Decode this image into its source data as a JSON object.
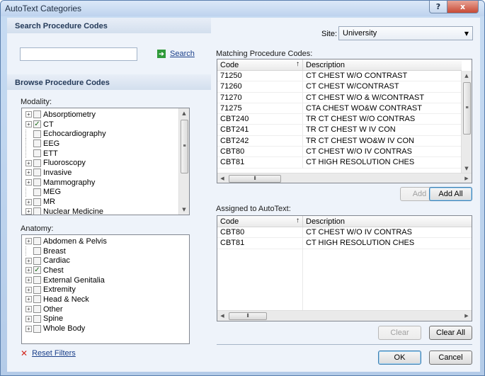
{
  "window": {
    "title": "AutoText Categories"
  },
  "titlebar": {
    "help": "?",
    "close": "x"
  },
  "search": {
    "header": "Search Procedure Codes",
    "input_value": "",
    "button_label": "Search"
  },
  "browse": {
    "header": "Browse Procedure Codes",
    "modality_label": "Modality:",
    "modality_items": [
      {
        "label": "Absorptiometry",
        "expandable": true,
        "checked": false
      },
      {
        "label": "CT",
        "expandable": true,
        "checked": true
      },
      {
        "label": "Echocardiography",
        "expandable": false,
        "checked": false
      },
      {
        "label": "EEG",
        "expandable": false,
        "checked": false
      },
      {
        "label": "ETT",
        "expandable": false,
        "checked": false
      },
      {
        "label": "Fluoroscopy",
        "expandable": true,
        "checked": false
      },
      {
        "label": "Invasive",
        "expandable": true,
        "checked": false
      },
      {
        "label": "Mammography",
        "expandable": true,
        "checked": false
      },
      {
        "label": "MEG",
        "expandable": false,
        "checked": false
      },
      {
        "label": "MR",
        "expandable": true,
        "checked": false
      },
      {
        "label": "Nuclear Medicine",
        "expandable": true,
        "checked": false
      }
    ],
    "anatomy_label": "Anatomy:",
    "anatomy_items": [
      {
        "label": "Abdomen & Pelvis",
        "expandable": true,
        "checked": false
      },
      {
        "label": "Breast",
        "expandable": false,
        "checked": false
      },
      {
        "label": "Cardiac",
        "expandable": true,
        "checked": false
      },
      {
        "label": "Chest",
        "expandable": true,
        "checked": true
      },
      {
        "label": "External Genitalia",
        "expandable": true,
        "checked": false
      },
      {
        "label": "Extremity",
        "expandable": true,
        "checked": false
      },
      {
        "label": "Head & Neck",
        "expandable": true,
        "checked": false
      },
      {
        "label": "Other",
        "expandable": true,
        "checked": false
      },
      {
        "label": "Spine",
        "expandable": true,
        "checked": false
      },
      {
        "label": "Whole Body",
        "expandable": true,
        "checked": false
      }
    ],
    "reset_label": "Reset Filters"
  },
  "site": {
    "label": "Site:",
    "value": "University"
  },
  "matching": {
    "label": "Matching Procedure Codes:",
    "col_code": "Code",
    "col_desc": "Description",
    "rows": [
      {
        "code": "71250",
        "desc": "CT CHEST W/O CONTRAST"
      },
      {
        "code": "71260",
        "desc": "CT CHEST W/CONTRAST"
      },
      {
        "code": "71270",
        "desc": "CT CHEST W/O & W/CONTRAST"
      },
      {
        "code": "71275",
        "desc": "CTA CHEST WO&W CONTRAST"
      },
      {
        "code": "CBT240",
        "desc": "TR CT CHEST W/O CONTRAS"
      },
      {
        "code": "CBT241",
        "desc": "TR CT CHEST W IV CON"
      },
      {
        "code": "CBT242",
        "desc": "TR CT CHEST WO&W IV CON"
      },
      {
        "code": "CBT80",
        "desc": "CT CHEST W/O IV CONTRAS"
      },
      {
        "code": "CBT81",
        "desc": "CT HIGH RESOLUTION CHES"
      }
    ],
    "add_label": "Add",
    "add_all_label": "Add All"
  },
  "assigned": {
    "label": "Assigned to AutoText:",
    "col_code": "Code",
    "col_desc": "Description",
    "rows": [
      {
        "code": "CBT80",
        "desc": "CT CHEST W/O IV CONTRAS"
      },
      {
        "code": "CBT81",
        "desc": "CT HIGH RESOLUTION CHES"
      }
    ],
    "clear_label": "Clear",
    "clear_all_label": "Clear All"
  },
  "footer": {
    "ok_label": "OK",
    "cancel_label": "Cancel"
  },
  "colors": {
    "accent": "#1a3f8a",
    "panel_bg": "#eef3fa",
    "window_bg": "#b4cbe8"
  }
}
